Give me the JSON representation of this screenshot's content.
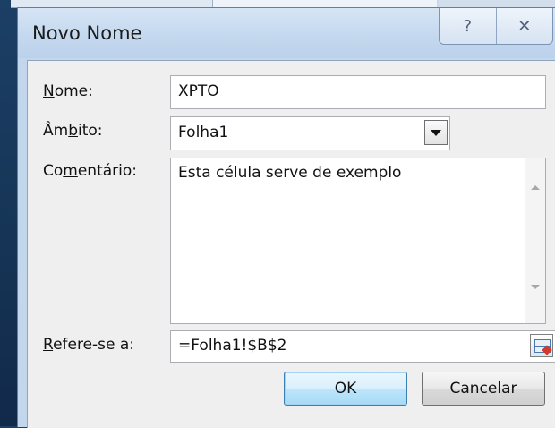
{
  "dialog": {
    "title": "Novo Nome",
    "help_glyph": "?",
    "close_glyph": "✕"
  },
  "fields": {
    "nome": {
      "label_pre": "",
      "label_ul": "N",
      "label_post": "ome:",
      "value": "XPTO"
    },
    "ambito": {
      "label_pre": "Âm",
      "label_ul": "b",
      "label_post": "ito:",
      "value": "Folha1"
    },
    "comentario": {
      "label_pre": "Co",
      "label_ul": "m",
      "label_post": "entário:",
      "value": "Esta célula serve de exemplo"
    },
    "refere": {
      "label_pre": "",
      "label_ul": "R",
      "label_post": "efere-se a:",
      "value": "=Folha1!$B$2"
    }
  },
  "buttons": {
    "ok": "OK",
    "cancel": "Cancelar"
  }
}
